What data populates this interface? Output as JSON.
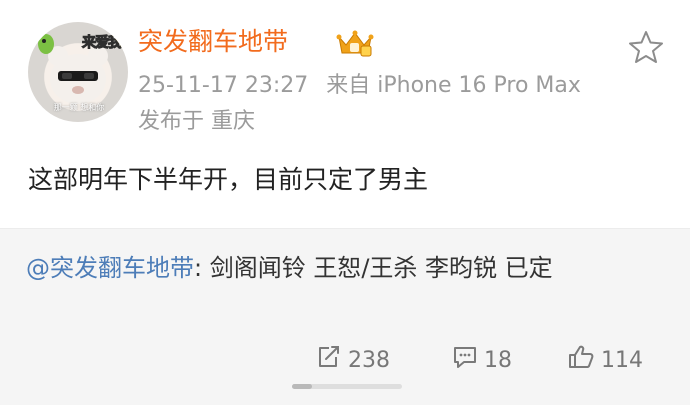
{
  "post": {
    "username": "突发翻车地带",
    "avatar_badge": "来爱我",
    "avatar_caption": "那一颗  想和你",
    "timestamp": "25-11-17 23:27",
    "source": "来自 iPhone 16 Pro Max",
    "location": "发布于 重庆",
    "content": "这部明年下半年开，目前只定了男主"
  },
  "repost": {
    "mention": "@突发翻车地带",
    "text": ": 剑阁闻铃 王恕/王杀 李昀锐 已定"
  },
  "actions": {
    "repost_count": "238",
    "comment_count": "18",
    "like_count": "114"
  },
  "scroll_indicator": {
    "position": 0.18
  },
  "colors": {
    "username": "#f26b1d",
    "mention": "#4d7db8",
    "repost_background": "#f5f5f5",
    "meta_text": "#9b9b9b",
    "crown_icon": "#f0a21a"
  },
  "icons": [
    "crown-icon",
    "star-icon",
    "repost-icon",
    "comment-icon",
    "like-icon"
  ]
}
